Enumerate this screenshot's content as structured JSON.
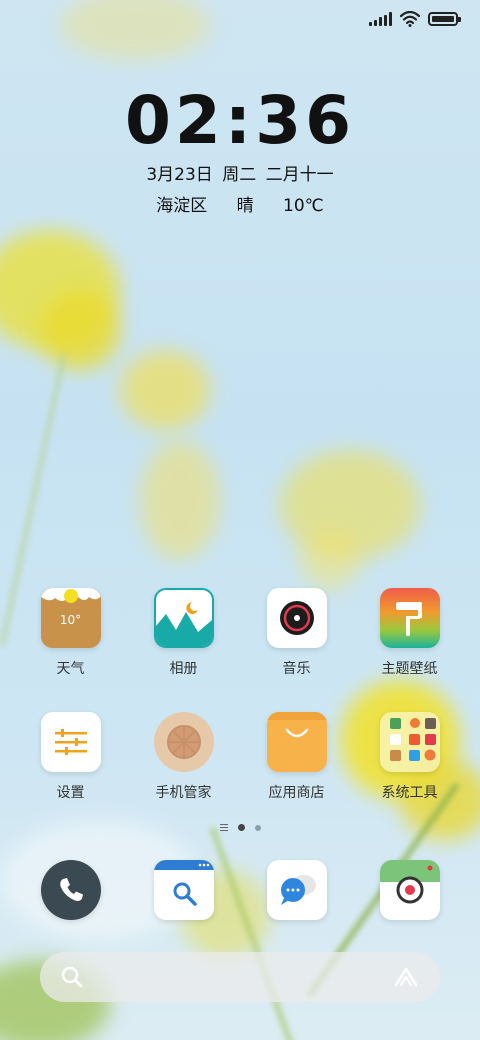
{
  "status_bar": {
    "icons": [
      "signal-icon",
      "wifi-icon",
      "battery-icon"
    ],
    "battery_level": 1.0
  },
  "lockclock": {
    "time": "02:36",
    "date": "3月23日",
    "weekday": "周二",
    "lunar_date": "二月十一",
    "location": "海淀区",
    "condition": "晴",
    "temperature": "10℃"
  },
  "apps_row1": [
    {
      "label": "天气",
      "icon": "weather-icon",
      "badge": "10°"
    },
    {
      "label": "相册",
      "icon": "gallery-icon"
    },
    {
      "label": "音乐",
      "icon": "music-icon"
    },
    {
      "label": "主题壁纸",
      "icon": "themes-icon"
    }
  ],
  "apps_row2": [
    {
      "label": "设置",
      "icon": "settings-icon"
    },
    {
      "label": "手机管家",
      "icon": "security-icon"
    },
    {
      "label": "应用商店",
      "icon": "app-store-icon"
    },
    {
      "label": "系统工具",
      "icon": "folder-icon"
    }
  ],
  "page_indicator": {
    "pages": 2,
    "active": 1
  },
  "dock": [
    {
      "icon": "phone-icon"
    },
    {
      "icon": "browser-icon"
    },
    {
      "icon": "messages-icon"
    },
    {
      "icon": "camera-icon"
    }
  ],
  "search": {
    "icons": [
      "search-icon",
      "assistant-icon"
    ]
  },
  "colors": {
    "sky": "#c6e2f2",
    "flower": "#f2e21c",
    "text": "#111111"
  }
}
